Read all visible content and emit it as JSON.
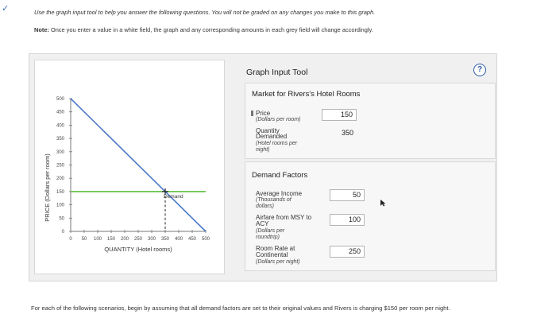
{
  "page": {
    "instruction": "Use the graph input tool to help you answer the following questions. You will not be graded on any changes you make to this graph.",
    "note_label": "Note:",
    "note_text": "Once you enter a value in a white field, the graph and any corresponding amounts in each grey field will change accordingly.",
    "footer": "For each of the following scenarios, begin by assuming that all demand factors are set to their original values and Rivers is charging $150 per room per night."
  },
  "tool": {
    "title": "Graph Input Tool",
    "help_symbol": "?",
    "market": {
      "title": "Market for Rivers's Hotel Rooms",
      "price_label": "Price",
      "price_unit": "(Dollars per room)",
      "price_value": "150",
      "qd_label_1": "Quantity",
      "qd_label_2": "Demanded",
      "qd_unit_1": "(Hotel rooms per",
      "qd_unit_2": "night)",
      "qd_value": "350"
    },
    "factors": {
      "title": "Demand Factors",
      "income_label": "Average Income",
      "income_unit_1": "(Thousands of",
      "income_unit_2": "dollars)",
      "income_value": "50",
      "airfare_label_1": "Airfare from MSY to",
      "airfare_label_2": "ACY",
      "airfare_unit_1": "(Dollars per",
      "airfare_unit_2": "roundtrip)",
      "airfare_value": "100",
      "room_label_1": "Room Rate at",
      "room_label_2": "Continental",
      "room_unit": "(Dollars per night)",
      "room_value": "250"
    }
  },
  "chart_data": {
    "type": "line",
    "xlabel": "QUANTITY (Hotel rooms)",
    "ylabel": "PRICE (Dollars per room)",
    "xlim": [
      0,
      500
    ],
    "ylim": [
      0,
      500
    ],
    "x_ticks": [
      "0",
      "50",
      "100",
      "150",
      "200",
      "250",
      "300",
      "350",
      "400",
      "450",
      "500"
    ],
    "y_ticks": [
      "0",
      "50",
      "100",
      "150",
      "200",
      "250",
      "300",
      "350",
      "400",
      "450",
      "500"
    ],
    "series": [
      {
        "name": "Demand",
        "color": "#4a78c8",
        "points": [
          [
            0,
            500
          ],
          [
            500,
            0
          ]
        ]
      }
    ],
    "price_line": {
      "y": 150,
      "color": "#5bbf3a"
    },
    "marker": {
      "x": 350,
      "y": 150
    }
  }
}
